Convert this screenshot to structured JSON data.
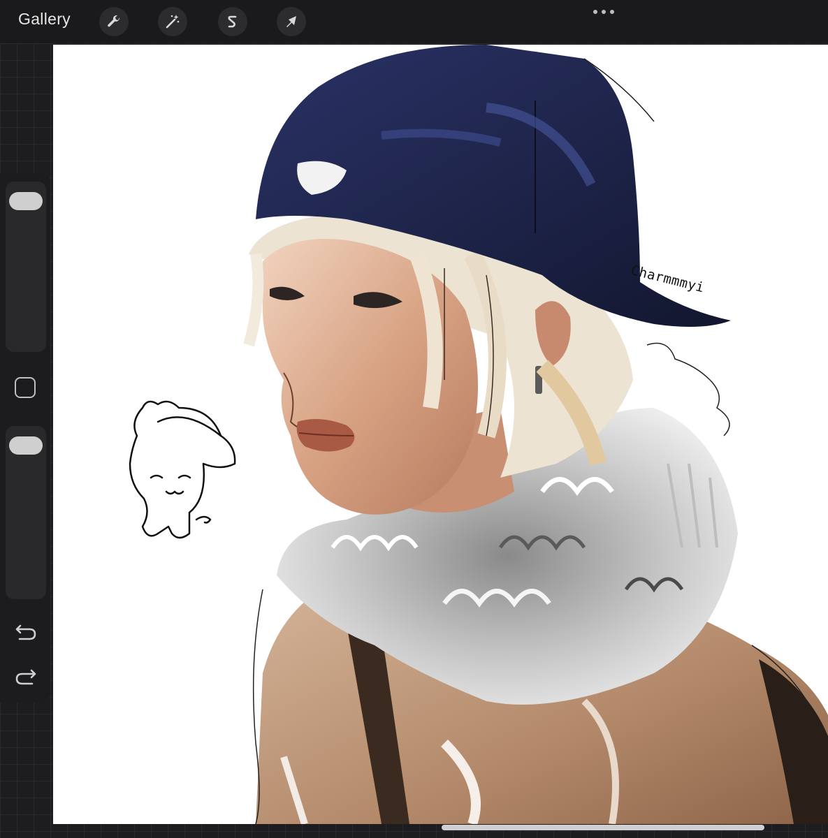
{
  "toolbar": {
    "gallery_label": "Gallery",
    "tools": [
      {
        "name": "wrench-icon",
        "label": "Actions"
      },
      {
        "name": "magic-wand-icon",
        "label": "Adjustments"
      },
      {
        "name": "selection-icon",
        "label": "Selection"
      },
      {
        "name": "transform-arrow-icon",
        "label": "Transform"
      }
    ],
    "more_icon": "ellipsis-icon"
  },
  "canvas": {
    "signature": "Charmmmyi"
  },
  "sidebar": {
    "brush_size_level": 0.95,
    "opacity_level": 0.95,
    "icons": [
      "modify-square-icon",
      "undo-icon",
      "redo-icon"
    ]
  },
  "colors": {
    "toolbar_bg": "#1a1a1c",
    "canvas_bg": "#ffffff",
    "cap": "#1f2547",
    "skin": "#d9a98a",
    "jacket": "#b08563"
  }
}
